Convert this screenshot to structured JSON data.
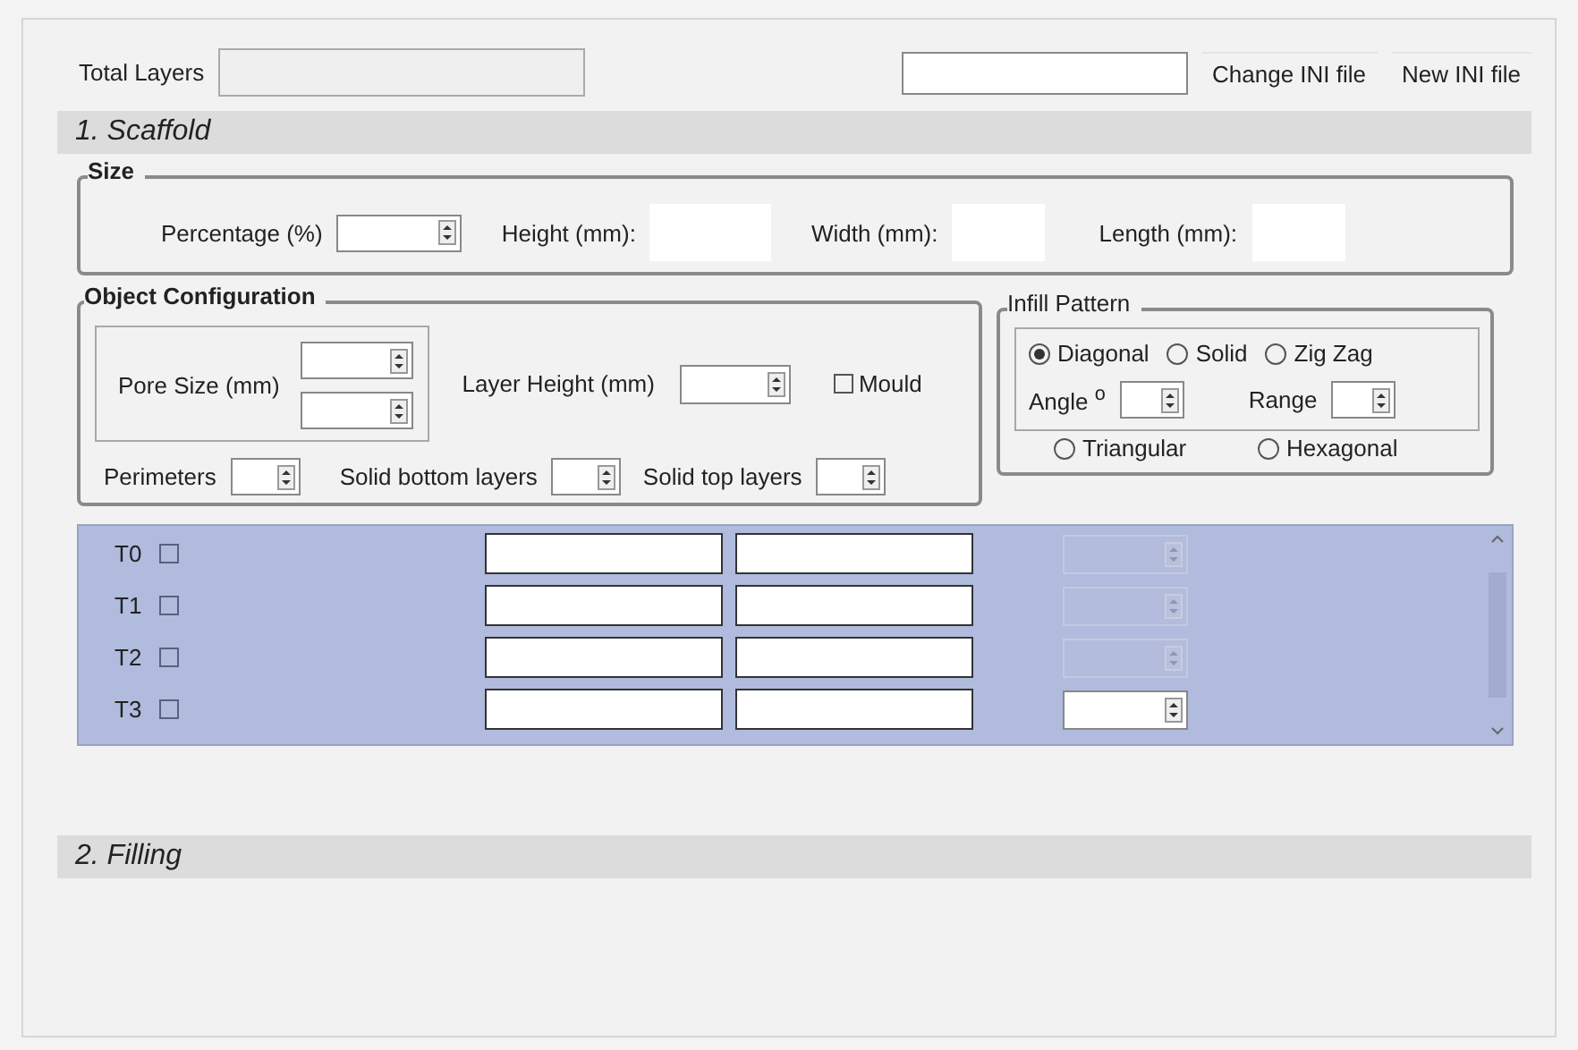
{
  "top_bar": {
    "total_layers_label": "Total Layers",
    "buttons": [
      "Change INI file",
      "New INI file"
    ]
  },
  "sections": [
    {
      "title": "1. Scaffold"
    },
    {
      "title": "2. Filling"
    }
  ],
  "size_group": {
    "title": "Size",
    "percentage_label": "Percentage (%)",
    "height_label": "Height (mm):",
    "width_label": "Width (mm):",
    "length_label": "Length (mm):"
  },
  "object_configuration": {
    "title": "Object Configuration",
    "pore_size_label": "Pore Size (mm)",
    "layer_height_label": "Layer Height (mm)",
    "mould": {
      "label": "Mould",
      "checked": false
    },
    "perimeters_label": "Perimeters",
    "solid_bottom_label": "Solid bottom layers",
    "solid_top_label": "Solid top layers"
  },
  "infill_pattern": {
    "title": "Infill Pattern",
    "options": [
      {
        "label": "Diagonal",
        "selected": true
      },
      {
        "label": "Solid",
        "selected": false
      },
      {
        "label": "Zig Zag",
        "selected": false
      },
      {
        "label": "Triangular",
        "selected": false
      },
      {
        "label": "Hexagonal",
        "selected": false
      }
    ],
    "angle_label": "Angle $^{o}$",
    "range_label": "Range"
  },
  "tools": [
    {
      "label": "T0",
      "checked": false,
      "disabled": true
    },
    {
      "label": "T1",
      "checked": false,
      "disabled": true
    },
    {
      "label": "T2",
      "checked": false,
      "disabled": true
    },
    {
      "label": "T3",
      "checked": false,
      "disabled": false
    }
  ]
}
